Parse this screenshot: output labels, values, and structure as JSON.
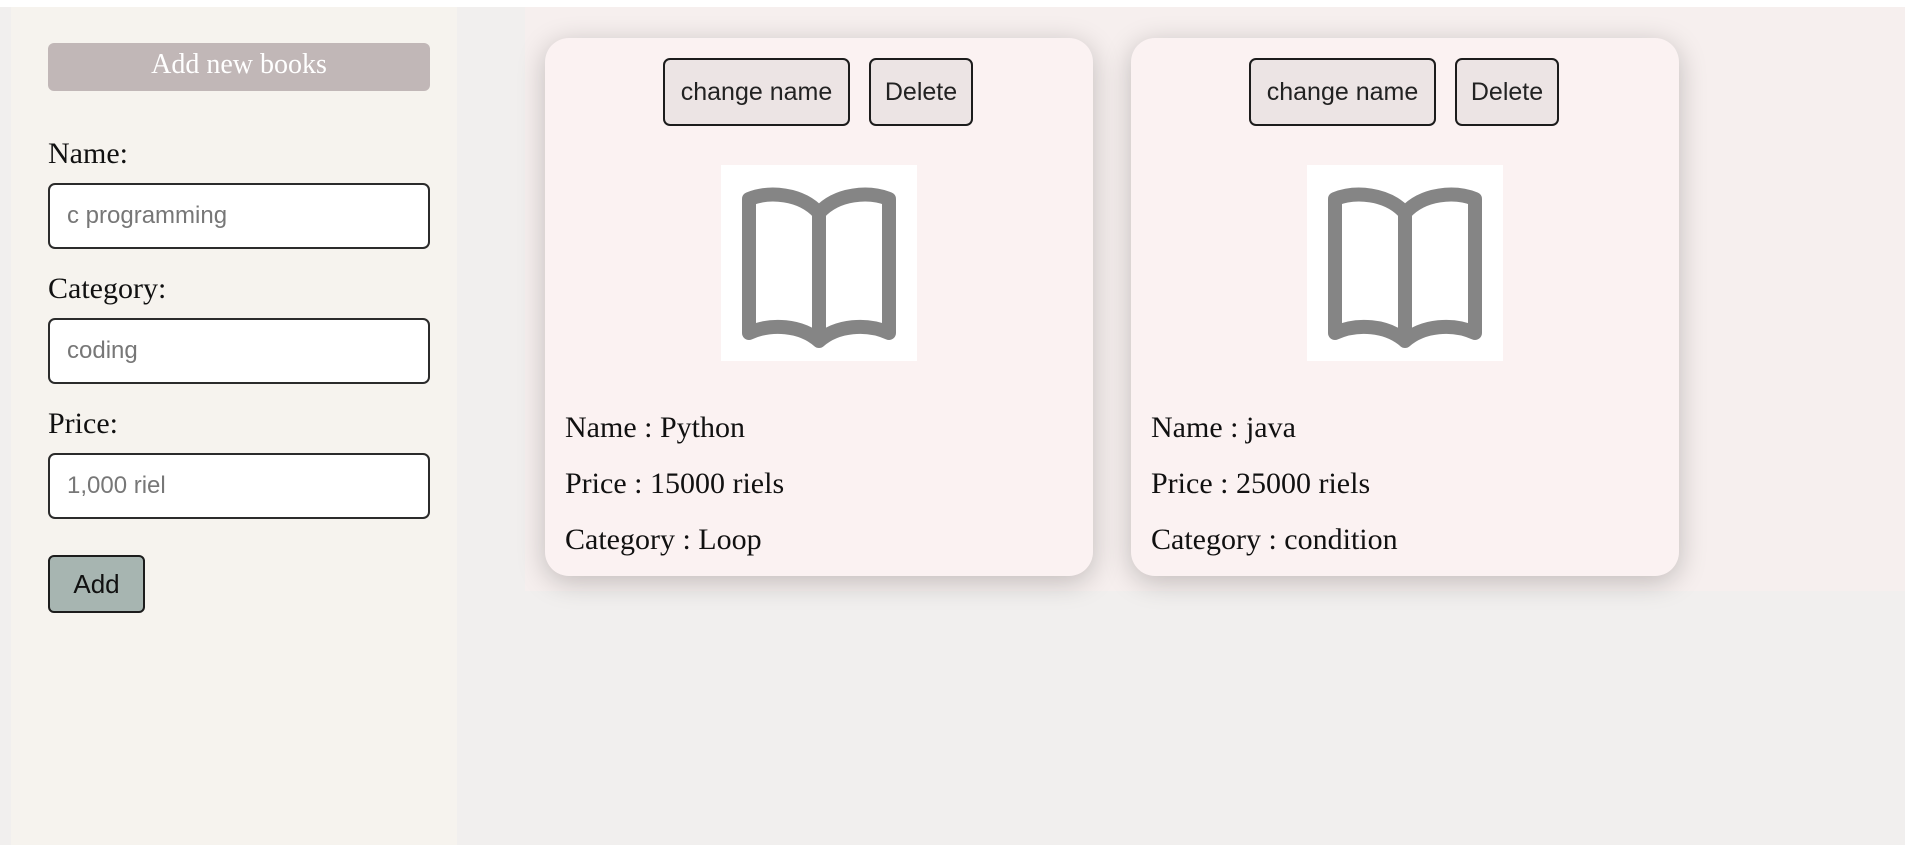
{
  "sidebar": {
    "title": "Add new books",
    "name_label": "Name:",
    "name_placeholder": "c programming",
    "category_label": "Category:",
    "category_placeholder": "coding",
    "price_label": "Price:",
    "price_placeholder": "1,000 riel",
    "add_label": "Add"
  },
  "books": [
    {
      "change_label": "change name",
      "delete_label": "Delete",
      "icon": "open-book-icon",
      "name_line": "Name : Python",
      "price_line": "Price : 15000 riels",
      "category_line": "Category : Loop"
    },
    {
      "change_label": "change name",
      "delete_label": "Delete",
      "icon": "open-book-icon",
      "name_line": "Name : java",
      "price_line": "Price : 25000 riels",
      "category_line": "Category : condition"
    }
  ],
  "colors": {
    "sidebar_header_bg": "#c1b7b7",
    "add_button_bg": "#a7b5b1",
    "card_bg": "#fbf2f2",
    "icon_gray": "#858585"
  }
}
